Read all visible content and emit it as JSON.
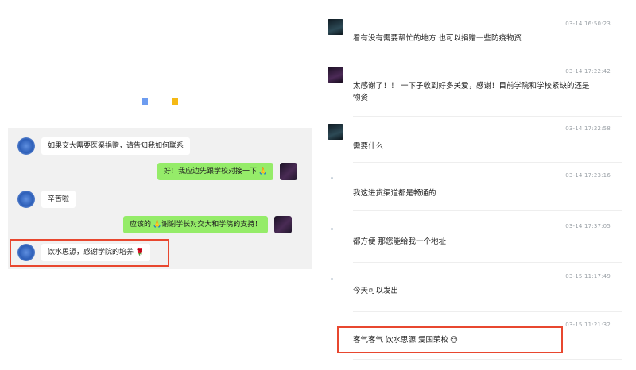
{
  "left_chat": {
    "messages": [
      {
        "side": "left",
        "text": "如果交大需要医渠捐赠，请告知我如何联系"
      },
      {
        "side": "right",
        "text": "好！我应边先跟学校对接一下",
        "emoji": "🙏"
      },
      {
        "side": "left",
        "text": "辛苦啦"
      },
      {
        "side": "right",
        "text": "应该的",
        "emoji": "🙏",
        "text2": "谢谢学长对交大和学院的支持！"
      },
      {
        "side": "left",
        "text": "饮水思源，感谢学院的培养",
        "emoji": "🌹"
      }
    ]
  },
  "right_comments": [
    {
      "time": "03-14 16:50:23",
      "text": "看有没有需要帮忙的地方 也可以捐赠一些防疫物资"
    },
    {
      "time": "03-14 17:22:42",
      "text": "太感谢了！！ 一下子收到好多关爱，感谢！目前学院和学校紧缺的还是物资"
    },
    {
      "time": "03-14 17:22:58",
      "text": "需要什么"
    },
    {
      "time": "03-14 17:23:16",
      "text": "我这进货渠道都是畅通的"
    },
    {
      "time": "03-14 17:37:05",
      "text": "都方便 那您能给我一个地址"
    },
    {
      "time": "03-15 11:17:49",
      "text": "今天可以发出"
    },
    {
      "time": "03-15 11:21:32",
      "text": "客气客气 饮水思源 爱国荣校",
      "emoji": "😉"
    }
  ],
  "colors": {
    "highlight": "#e8472f",
    "green_bubble": "#95ec69",
    "chat_bg": "#f1f1f1"
  }
}
